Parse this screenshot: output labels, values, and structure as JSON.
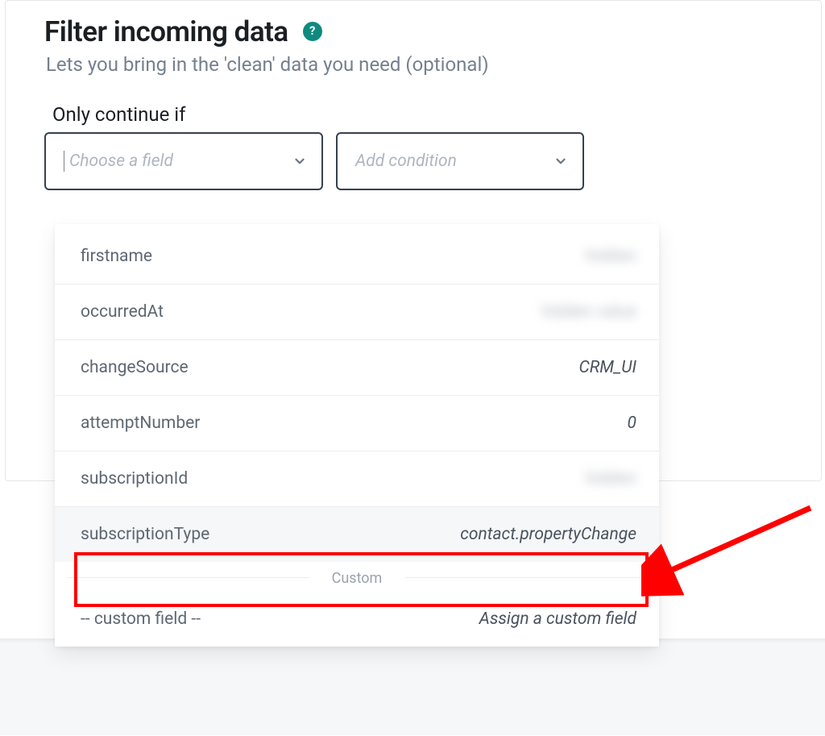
{
  "header": {
    "title": "Filter incoming data",
    "subtitle": "Lets you bring in the 'clean' data you need (optional)",
    "help_tooltip": "?"
  },
  "filter": {
    "only_label": "Only continue if",
    "field_placeholder": "Choose a field",
    "condition_placeholder": "Add condition"
  },
  "dropdown": {
    "items": [
      {
        "label": "firstname",
        "value": "hidden",
        "blurred": true
      },
      {
        "label": "occurredAt",
        "value": "hidden value",
        "blurred": true
      },
      {
        "label": "changeSource",
        "value": "CRM_UI",
        "blurred": false
      },
      {
        "label": "attemptNumber",
        "value": "0",
        "blurred": false
      },
      {
        "label": "subscriptionId",
        "value": "hidden",
        "blurred": true
      },
      {
        "label": "subscriptionType",
        "value": "contact.propertyChange",
        "blurred": false,
        "highlighted": true
      }
    ],
    "custom_section_label": "Custom",
    "custom_item": {
      "label": "-- custom field --",
      "value": "Assign a custom field"
    }
  }
}
